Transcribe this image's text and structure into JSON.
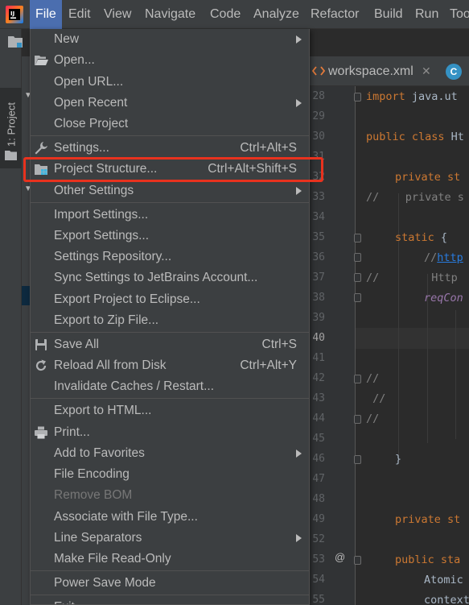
{
  "menubar": {
    "items": [
      "File",
      "Edit",
      "View",
      "Navigate",
      "Code",
      "Analyze",
      "Refactor",
      "Build",
      "Run",
      "Too"
    ]
  },
  "tool_window": {
    "project_tab": "1: Project"
  },
  "editor": {
    "tabs": [
      {
        "label": "workspace.xml",
        "icon": "xml-file-icon"
      },
      {
        "label": "C",
        "icon": "java-class-icon"
      }
    ],
    "line_numbers": [
      "28",
      "29",
      "30",
      "31",
      "32",
      "33",
      "34",
      "35",
      "36",
      "37",
      "38",
      "39",
      "40",
      "41",
      "42",
      "43",
      "44",
      "45",
      "46",
      "47",
      "48",
      "49",
      "52",
      "53",
      "54",
      "55"
    ],
    "current_line": "40",
    "code": {
      "l28a": "import",
      "l28b": " java.ut",
      "l30a": "public class",
      "l30b": " Ht",
      "l32": "private st",
      "l33": "//    private s",
      "l35": "static",
      "l35b": " {",
      "l36a": "//",
      "l36b": "http",
      "l37": "//        Http",
      "l38": "reqCon",
      "l42": "//",
      "l43": " //",
      "l44": "//",
      "l46": "}",
      "l49": "private st",
      "l53a": "public",
      "l53b": " sta",
      "l54": "Atomic",
      "l55": "context"
    },
    "gutter_marker": "@"
  },
  "file_menu": {
    "items": [
      {
        "label": "New",
        "submenu": true
      },
      {
        "label": "Open...",
        "icon": "open-folder-icon"
      },
      {
        "label": "Open URL..."
      },
      {
        "label": "Open Recent",
        "submenu": true
      },
      {
        "label": "Close Project"
      },
      {
        "label": "Settings...",
        "shortcut": "Ctrl+Alt+S",
        "icon": "wrench-icon"
      },
      {
        "label": "Project Structure...",
        "shortcut": "Ctrl+Alt+Shift+S",
        "icon": "project-structure-icon"
      },
      {
        "label": "Other Settings",
        "submenu": true
      },
      {
        "label": "Import Settings..."
      },
      {
        "label": "Export Settings..."
      },
      {
        "label": "Settings Repository..."
      },
      {
        "label": "Sync Settings to JetBrains Account..."
      },
      {
        "label": "Export Project to Eclipse..."
      },
      {
        "label": "Export to Zip File..."
      },
      {
        "label": "Save All",
        "shortcut": "Ctrl+S",
        "icon": "save-icon"
      },
      {
        "label": "Reload All from Disk",
        "shortcut": "Ctrl+Alt+Y",
        "icon": "reload-icon"
      },
      {
        "label": "Invalidate Caches / Restart..."
      },
      {
        "label": "Export to HTML..."
      },
      {
        "label": "Print...",
        "icon": "printer-icon"
      },
      {
        "label": "Add to Favorites",
        "submenu": true
      },
      {
        "label": "File Encoding"
      },
      {
        "label": "Remove BOM",
        "disabled": true
      },
      {
        "label": "Associate with File Type..."
      },
      {
        "label": "Line Separators",
        "submenu": true
      },
      {
        "label": "Make File Read-Only"
      },
      {
        "label": "Power Save Mode"
      },
      {
        "label": "Exit"
      }
    ],
    "highlighted_item": "Project Structure...",
    "annotation_color": "#e8321e"
  },
  "colors": {
    "menubar_bg": "#3c3f41",
    "menu_active": "#4b6eaf",
    "editor_bg": "#2b2b2b",
    "keyword": "#cc7832",
    "comment": "#808080",
    "link": "#287bde",
    "field": "#9876aa"
  }
}
